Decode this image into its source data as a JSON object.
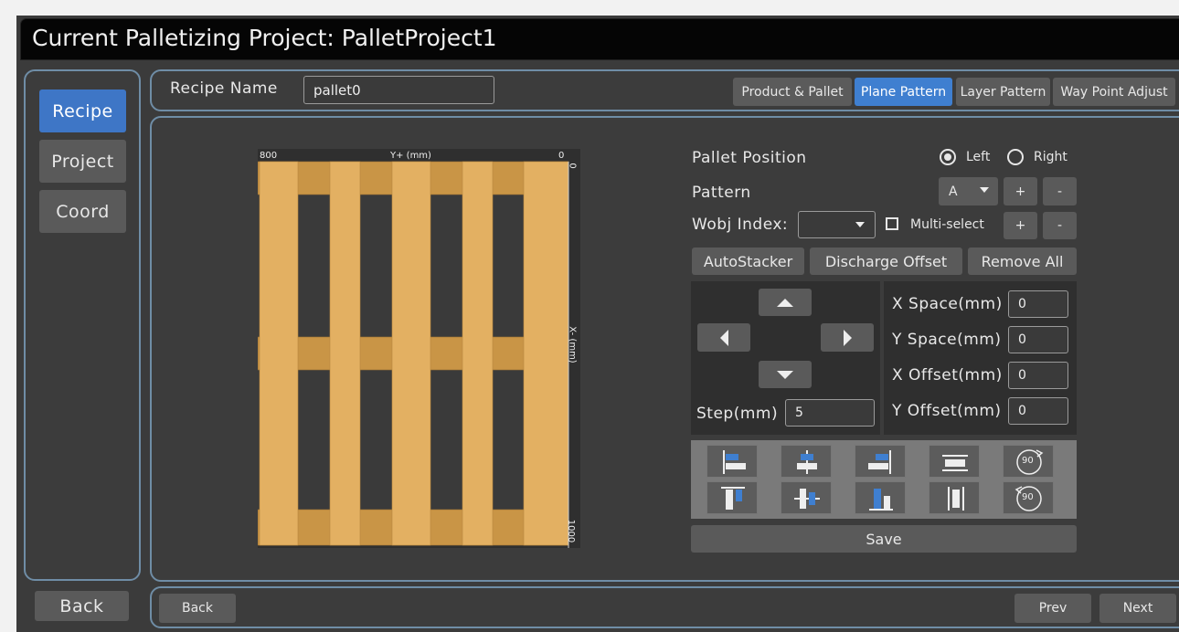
{
  "window": {
    "title": "Current Palletizing Project: PalletProject1"
  },
  "sidebar": {
    "items": [
      {
        "label": "Recipe",
        "active": true
      },
      {
        "label": "Project",
        "active": false
      },
      {
        "label": "Coord",
        "active": false
      }
    ],
    "back_label": "Back"
  },
  "header": {
    "recipe_name_label": "Recipe Name",
    "recipe_name_value": "pallet0"
  },
  "tabs": [
    {
      "label": "Product & Pallet",
      "active": false
    },
    {
      "label": "Plane Pattern",
      "active": true
    },
    {
      "label": "Layer Pattern",
      "active": false
    },
    {
      "label": "Way Point Adjust",
      "active": false
    }
  ],
  "pallet_view": {
    "top_left_label": "800",
    "top_axis_label": "Y+ (mm)",
    "top_right_label": "0",
    "right_axis_label": "X- (mm)",
    "bottom_right_label": "1000"
  },
  "controls": {
    "pallet_position_label": "Pallet Position",
    "position_options": [
      {
        "label": "Left",
        "selected": true
      },
      {
        "label": "Right",
        "selected": false
      }
    ],
    "pattern_label": "Pattern",
    "pattern_value": "A",
    "wobj_index_label": "Wobj Index:",
    "wobj_index_value": "",
    "multiselect_label": "Multi-select",
    "plus_label": "+",
    "minus_label": "-",
    "autostacker_label": "AutoStacker",
    "discharge_offset_label": "Discharge Offset",
    "remove_all_label": "Remove All",
    "step_label": "Step(mm)",
    "step_value": "5",
    "x_space_label": "X Space(mm)",
    "x_space_value": "0",
    "y_space_label": "Y Space(mm)",
    "y_space_value": "0",
    "x_offset_label": "X Offset(mm)",
    "x_offset_value": "0",
    "y_offset_label": "Y Offset(mm)",
    "y_offset_value": "0",
    "rotate_label": "90",
    "save_label": "Save"
  },
  "footer": {
    "back_label": "Back",
    "prev_label": "Prev",
    "next_label": "Next"
  },
  "colors": {
    "accent": "#3f7fd0",
    "wood_light": "#e3b062",
    "wood_dark": "#c99546",
    "gap": "#3a3a3a"
  }
}
